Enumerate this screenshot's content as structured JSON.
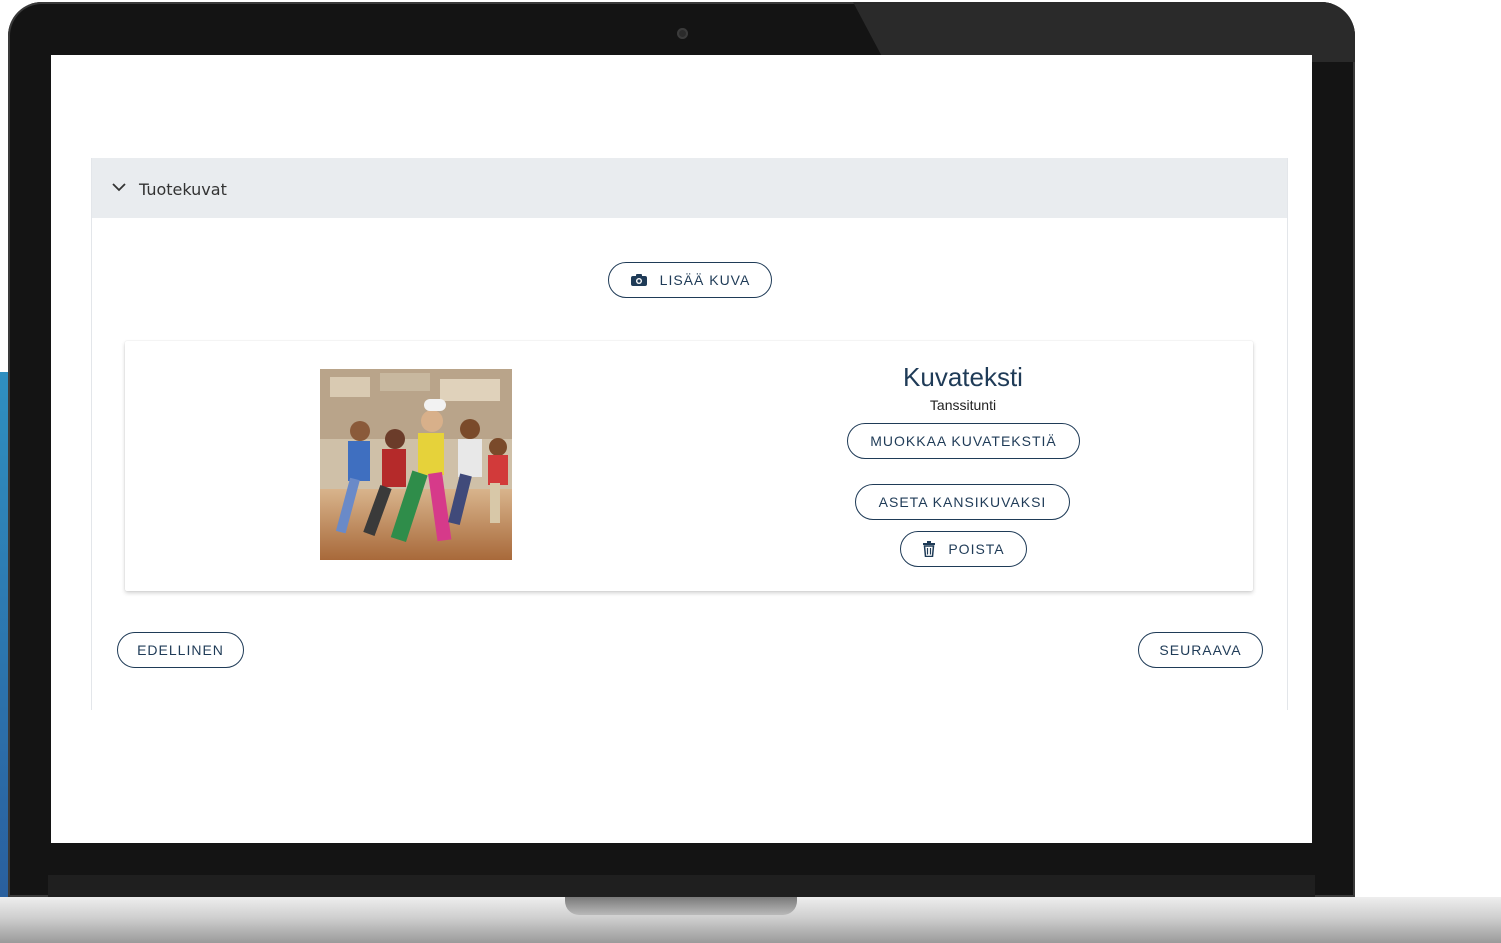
{
  "section": {
    "title": "Tuotekuvat"
  },
  "actions": {
    "add_image": "LISÄÄ KUVA"
  },
  "image_card": {
    "caption_heading": "Kuvateksti",
    "caption_value": "Tanssitunti",
    "edit_caption": "MUOKKAA KUVATEKSTIÄ",
    "set_cover": "ASETA KANSIKUVAKSI",
    "delete": "POISTA"
  },
  "navigation": {
    "previous": "EDELLINEN",
    "next": "SEURAAVA"
  },
  "colors": {
    "accent": "#1f3b57",
    "header_bg": "#e9ecef"
  },
  "icons": {
    "add_image": "camera-icon",
    "delete": "trash-icon",
    "collapse": "chevron-down-icon"
  }
}
